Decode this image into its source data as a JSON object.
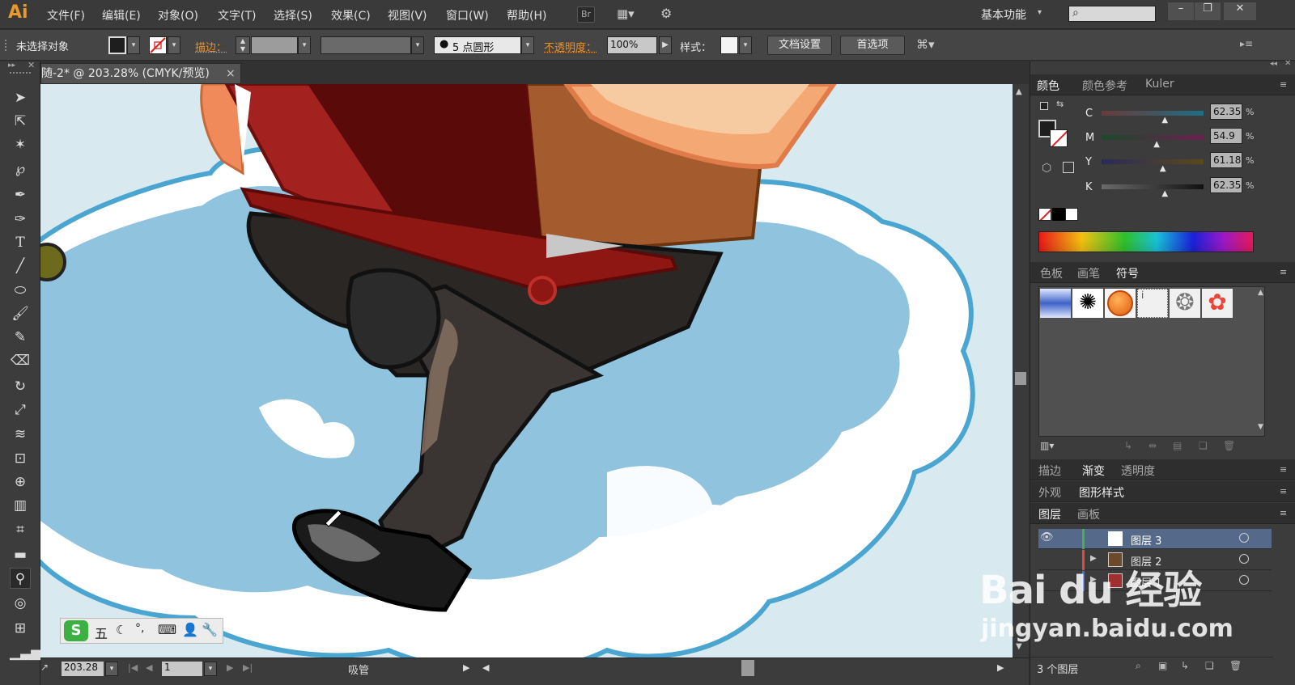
{
  "app": {
    "logo": "Ai",
    "workspace": "基本功能",
    "search_icon": "⌕",
    "bridge_label": "Br"
  },
  "menu": [
    "文件(F)",
    "编辑(E)",
    "对象(O)",
    "文字(T)",
    "选择(S)",
    "效果(C)",
    "视图(V)",
    "窗口(W)",
    "帮助(H)"
  ],
  "control": {
    "selection_status": "未选择对象",
    "stroke_label": "描边：",
    "brush_label": "5 点圆形",
    "opacity_label": "不透明度：",
    "opacity_value": "100%",
    "style_label": "样式：",
    "doc_setup": "文档设置",
    "preferences": "首选项"
  },
  "document": {
    "tab_title": "随-2* @ 203.28% (CMYK/预览)",
    "close": "×"
  },
  "status": {
    "zoom": "203.28",
    "artboard": "1",
    "tool": "吸管"
  },
  "color_panel": {
    "tabs": [
      "颜色",
      "颜色参考",
      "Kuler"
    ],
    "channels": [
      {
        "name": "C",
        "value": "62.35",
        "pct": "%",
        "level": 0.63
      },
      {
        "name": "M",
        "value": "54.9",
        "pct": "%",
        "level": 0.55
      },
      {
        "name": "Y",
        "value": "61.18",
        "pct": "%",
        "level": 0.61
      },
      {
        "name": "K",
        "value": "62.35",
        "pct": "%",
        "level": 0.63
      }
    ]
  },
  "symbol_panel": {
    "tabs": [
      "色板",
      "画笔",
      "符号"
    ]
  },
  "stroke_panel": {
    "tabs": [
      "描边",
      "渐变",
      "透明度"
    ]
  },
  "appearance_panel": {
    "tabs": [
      "外观",
      "图形样式"
    ]
  },
  "layers_panel": {
    "tabs": [
      "图层",
      "画板"
    ],
    "layers": [
      {
        "name": "图层 3",
        "color": "#3fb34f"
      },
      {
        "name": "图层 2",
        "color": "#e04848"
      },
      {
        "name": "图层 1",
        "color": "#3d6fe0"
      }
    ],
    "count": "3 个图层"
  },
  "ime": {
    "label": "五"
  },
  "watermark": {
    "brand": "Bai du 经验",
    "url": "jingyan.baidu.com"
  },
  "colors": {
    "accent_orange": "#e8912d",
    "cloud_blue": "#8fc3de",
    "cloud_edge": "#4aa6d0",
    "book_red": "#a3221f",
    "pants": "#2a2725"
  }
}
